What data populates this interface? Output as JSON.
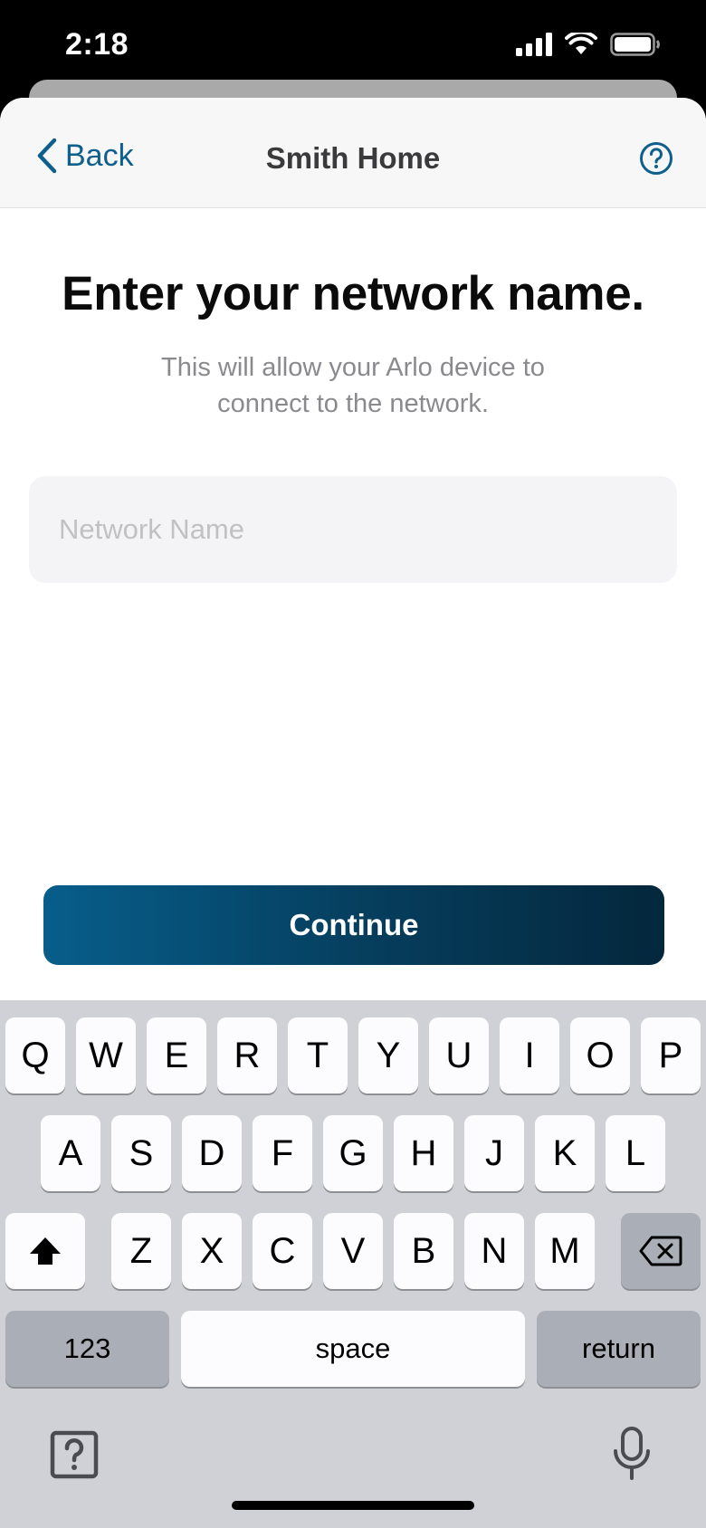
{
  "status_bar": {
    "time": "2:18",
    "icons": [
      "signal-icon",
      "wifi-icon",
      "battery-icon"
    ]
  },
  "nav": {
    "back_label": "Back",
    "title": "Smith Home",
    "help_icon": "help-icon"
  },
  "main": {
    "heading": "Enter your network name.",
    "subtext": "This will allow your Arlo device to connect to the network.",
    "input_placeholder": "Network Name",
    "input_value": "",
    "continue_label": "Continue"
  },
  "keyboard": {
    "row1": [
      "Q",
      "W",
      "E",
      "R",
      "T",
      "Y",
      "U",
      "I",
      "O",
      "P"
    ],
    "row2": [
      "A",
      "S",
      "D",
      "F",
      "G",
      "H",
      "J",
      "K",
      "L"
    ],
    "row3": [
      "Z",
      "X",
      "C",
      "V",
      "B",
      "N",
      "M"
    ],
    "numbers_label": "123",
    "space_label": "space",
    "return_label": "return",
    "icons": [
      "shift-icon",
      "delete-icon",
      "keyboard-help-icon",
      "microphone-icon"
    ]
  },
  "colors": {
    "accent": "#0e5f8c",
    "button_start": "#075e8b",
    "button_end": "#04273c",
    "keyboard_bg": "#cfd1d6"
  }
}
